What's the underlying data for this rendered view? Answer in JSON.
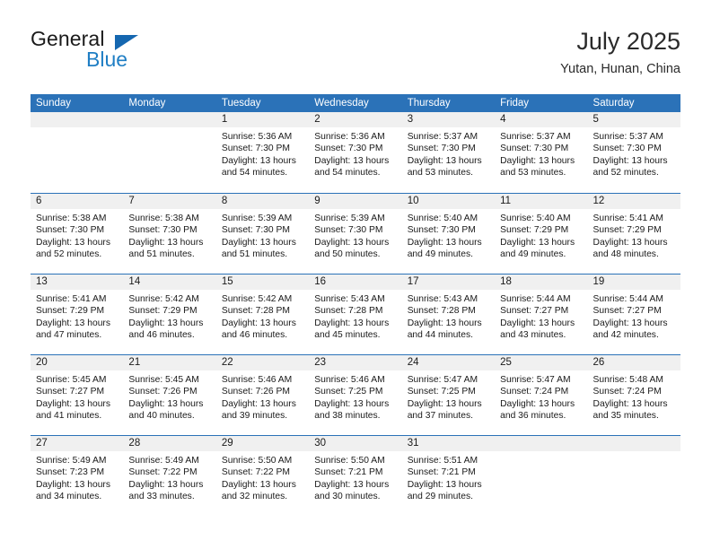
{
  "brand": {
    "name_top": "General",
    "name_bottom": "Blue",
    "triangle_color": "#1567b0",
    "blue_color": "#1f7ec4"
  },
  "header": {
    "title": "July 2025",
    "subtitle": "Yutan, Hunan, China"
  },
  "theme": {
    "header_blue": "#2b72b8",
    "daynum_band": "#f0f0f0",
    "text": "#1a1a1a"
  },
  "calendar": {
    "weekday_headers": [
      "Sunday",
      "Monday",
      "Tuesday",
      "Wednesday",
      "Thursday",
      "Friday",
      "Saturday"
    ],
    "weeks": [
      [
        {
          "day": "",
          "sunrise": "",
          "sunset": "",
          "daylight": ""
        },
        {
          "day": "",
          "sunrise": "",
          "sunset": "",
          "daylight": ""
        },
        {
          "day": "1",
          "sunrise": "Sunrise: 5:36 AM",
          "sunset": "Sunset: 7:30 PM",
          "daylight": "Daylight: 13 hours and 54 minutes."
        },
        {
          "day": "2",
          "sunrise": "Sunrise: 5:36 AM",
          "sunset": "Sunset: 7:30 PM",
          "daylight": "Daylight: 13 hours and 54 minutes."
        },
        {
          "day": "3",
          "sunrise": "Sunrise: 5:37 AM",
          "sunset": "Sunset: 7:30 PM",
          "daylight": "Daylight: 13 hours and 53 minutes."
        },
        {
          "day": "4",
          "sunrise": "Sunrise: 5:37 AM",
          "sunset": "Sunset: 7:30 PM",
          "daylight": "Daylight: 13 hours and 53 minutes."
        },
        {
          "day": "5",
          "sunrise": "Sunrise: 5:37 AM",
          "sunset": "Sunset: 7:30 PM",
          "daylight": "Daylight: 13 hours and 52 minutes."
        }
      ],
      [
        {
          "day": "6",
          "sunrise": "Sunrise: 5:38 AM",
          "sunset": "Sunset: 7:30 PM",
          "daylight": "Daylight: 13 hours and 52 minutes."
        },
        {
          "day": "7",
          "sunrise": "Sunrise: 5:38 AM",
          "sunset": "Sunset: 7:30 PM",
          "daylight": "Daylight: 13 hours and 51 minutes."
        },
        {
          "day": "8",
          "sunrise": "Sunrise: 5:39 AM",
          "sunset": "Sunset: 7:30 PM",
          "daylight": "Daylight: 13 hours and 51 minutes."
        },
        {
          "day": "9",
          "sunrise": "Sunrise: 5:39 AM",
          "sunset": "Sunset: 7:30 PM",
          "daylight": "Daylight: 13 hours and 50 minutes."
        },
        {
          "day": "10",
          "sunrise": "Sunrise: 5:40 AM",
          "sunset": "Sunset: 7:30 PM",
          "daylight": "Daylight: 13 hours and 49 minutes."
        },
        {
          "day": "11",
          "sunrise": "Sunrise: 5:40 AM",
          "sunset": "Sunset: 7:29 PM",
          "daylight": "Daylight: 13 hours and 49 minutes."
        },
        {
          "day": "12",
          "sunrise": "Sunrise: 5:41 AM",
          "sunset": "Sunset: 7:29 PM",
          "daylight": "Daylight: 13 hours and 48 minutes."
        }
      ],
      [
        {
          "day": "13",
          "sunrise": "Sunrise: 5:41 AM",
          "sunset": "Sunset: 7:29 PM",
          "daylight": "Daylight: 13 hours and 47 minutes."
        },
        {
          "day": "14",
          "sunrise": "Sunrise: 5:42 AM",
          "sunset": "Sunset: 7:29 PM",
          "daylight": "Daylight: 13 hours and 46 minutes."
        },
        {
          "day": "15",
          "sunrise": "Sunrise: 5:42 AM",
          "sunset": "Sunset: 7:28 PM",
          "daylight": "Daylight: 13 hours and 46 minutes."
        },
        {
          "day": "16",
          "sunrise": "Sunrise: 5:43 AM",
          "sunset": "Sunset: 7:28 PM",
          "daylight": "Daylight: 13 hours and 45 minutes."
        },
        {
          "day": "17",
          "sunrise": "Sunrise: 5:43 AM",
          "sunset": "Sunset: 7:28 PM",
          "daylight": "Daylight: 13 hours and 44 minutes."
        },
        {
          "day": "18",
          "sunrise": "Sunrise: 5:44 AM",
          "sunset": "Sunset: 7:27 PM",
          "daylight": "Daylight: 13 hours and 43 minutes."
        },
        {
          "day": "19",
          "sunrise": "Sunrise: 5:44 AM",
          "sunset": "Sunset: 7:27 PM",
          "daylight": "Daylight: 13 hours and 42 minutes."
        }
      ],
      [
        {
          "day": "20",
          "sunrise": "Sunrise: 5:45 AM",
          "sunset": "Sunset: 7:27 PM",
          "daylight": "Daylight: 13 hours and 41 minutes."
        },
        {
          "day": "21",
          "sunrise": "Sunrise: 5:45 AM",
          "sunset": "Sunset: 7:26 PM",
          "daylight": "Daylight: 13 hours and 40 minutes."
        },
        {
          "day": "22",
          "sunrise": "Sunrise: 5:46 AM",
          "sunset": "Sunset: 7:26 PM",
          "daylight": "Daylight: 13 hours and 39 minutes."
        },
        {
          "day": "23",
          "sunrise": "Sunrise: 5:46 AM",
          "sunset": "Sunset: 7:25 PM",
          "daylight": "Daylight: 13 hours and 38 minutes."
        },
        {
          "day": "24",
          "sunrise": "Sunrise: 5:47 AM",
          "sunset": "Sunset: 7:25 PM",
          "daylight": "Daylight: 13 hours and 37 minutes."
        },
        {
          "day": "25",
          "sunrise": "Sunrise: 5:47 AM",
          "sunset": "Sunset: 7:24 PM",
          "daylight": "Daylight: 13 hours and 36 minutes."
        },
        {
          "day": "26",
          "sunrise": "Sunrise: 5:48 AM",
          "sunset": "Sunset: 7:24 PM",
          "daylight": "Daylight: 13 hours and 35 minutes."
        }
      ],
      [
        {
          "day": "27",
          "sunrise": "Sunrise: 5:49 AM",
          "sunset": "Sunset: 7:23 PM",
          "daylight": "Daylight: 13 hours and 34 minutes."
        },
        {
          "day": "28",
          "sunrise": "Sunrise: 5:49 AM",
          "sunset": "Sunset: 7:22 PM",
          "daylight": "Daylight: 13 hours and 33 minutes."
        },
        {
          "day": "29",
          "sunrise": "Sunrise: 5:50 AM",
          "sunset": "Sunset: 7:22 PM",
          "daylight": "Daylight: 13 hours and 32 minutes."
        },
        {
          "day": "30",
          "sunrise": "Sunrise: 5:50 AM",
          "sunset": "Sunset: 7:21 PM",
          "daylight": "Daylight: 13 hours and 30 minutes."
        },
        {
          "day": "31",
          "sunrise": "Sunrise: 5:51 AM",
          "sunset": "Sunset: 7:21 PM",
          "daylight": "Daylight: 13 hours and 29 minutes."
        },
        {
          "day": "",
          "sunrise": "",
          "sunset": "",
          "daylight": ""
        },
        {
          "day": "",
          "sunrise": "",
          "sunset": "",
          "daylight": ""
        }
      ]
    ]
  }
}
